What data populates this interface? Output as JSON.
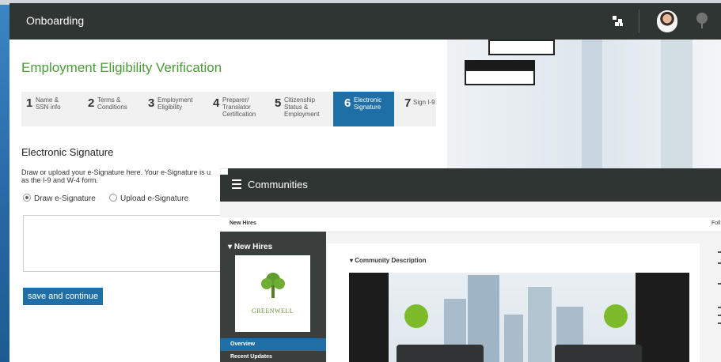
{
  "onboarding": {
    "app_title": "Onboarding",
    "page_title": "Employment Eligibility Verification",
    "steps": [
      {
        "num": "1",
        "label": "Name &\nSSN info"
      },
      {
        "num": "2",
        "label": "Terms &\nConditions"
      },
      {
        "num": "3",
        "label": "Employment\nEligibility"
      },
      {
        "num": "4",
        "label": "Preparer/\nTranslator\nCertification"
      },
      {
        "num": "5",
        "label": "Citizenship\nStatus &\nEmployment"
      },
      {
        "num": "6",
        "label": "Electronic\nSignature"
      },
      {
        "num": "7",
        "label": "Sign I-9"
      }
    ],
    "active_step": 6,
    "section_heading": "Electronic Signature",
    "description": "Draw or upload your e-Signature here. Your e-Signature is u\nas the I-9 and W-4 form.",
    "option_draw": "Draw e-Signature",
    "option_upload": "Upload e-Signature",
    "selected_option": "Draw e-Signature",
    "save_button": "save and continue",
    "icons": [
      "grid-icon",
      "avatar",
      "tree-icon"
    ]
  },
  "communities": {
    "app_title": "Communities",
    "subheader": "New Hires",
    "follow_text": "Foll",
    "nav_header": "New Hires",
    "logo_text": "GREENWELL",
    "nav_items": [
      "Overview",
      "Recent Updates"
    ],
    "active_nav": "Overview",
    "section_title": "Community Description"
  },
  "colors": {
    "accent_blue": "#1f6fa6",
    "title_green": "#4b9a3a",
    "header_dark": "#2f3533"
  }
}
